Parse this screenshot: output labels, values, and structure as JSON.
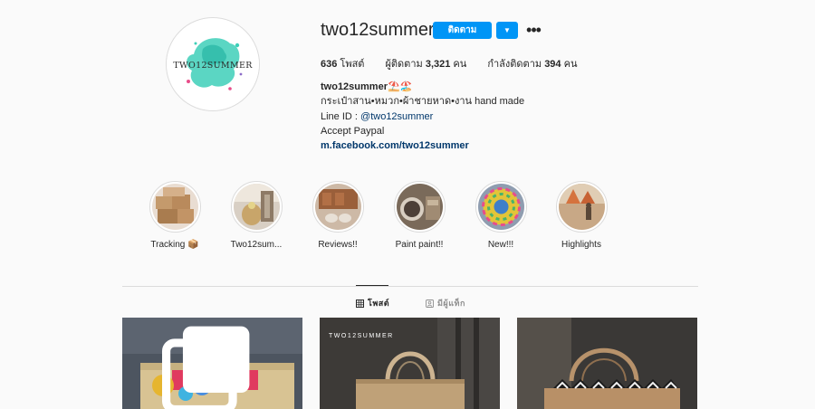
{
  "profile": {
    "username": "two12summer",
    "follow_label": "ติดตาม",
    "avatar_text": "TWO12SUMMER",
    "stats": {
      "posts_count": "636",
      "posts_label": "โพสต์",
      "followers_label": "ผู้ติดตาม",
      "followers_count": "3,321",
      "followers_unit": "คน",
      "following_label": "กำลังติดตาม",
      "following_count": "394",
      "following_unit": "คน"
    },
    "bio": {
      "name": "two12summer⛱️🏖️",
      "line1": "กระเป๋าสาน•หมวก•ผ้าชายหาด•งาน hand made",
      "line2_prefix": "Line ID : ",
      "line2_handle": "@two12summer",
      "line3": "Accept Paypal",
      "website": "m.facebook.com/two12summer"
    }
  },
  "highlights": [
    {
      "label": "Tracking 📦"
    },
    {
      "label": "Two12sum..."
    },
    {
      "label": "Reviews!!"
    },
    {
      "label": "Paint paint!!"
    },
    {
      "label": "New!!!"
    },
    {
      "label": "Highlights"
    }
  ],
  "tabs": {
    "posts": "โพสต์",
    "tagged": "มีผู้แท็ก"
  },
  "posts": [
    {
      "watermark": ""
    },
    {
      "watermark": "TWO12SUMMER"
    },
    {
      "watermark": ""
    }
  ],
  "colors": {
    "accent": "#0095f6",
    "link": "#00376b",
    "border": "#dbdbdb",
    "background": "#fafafa"
  }
}
